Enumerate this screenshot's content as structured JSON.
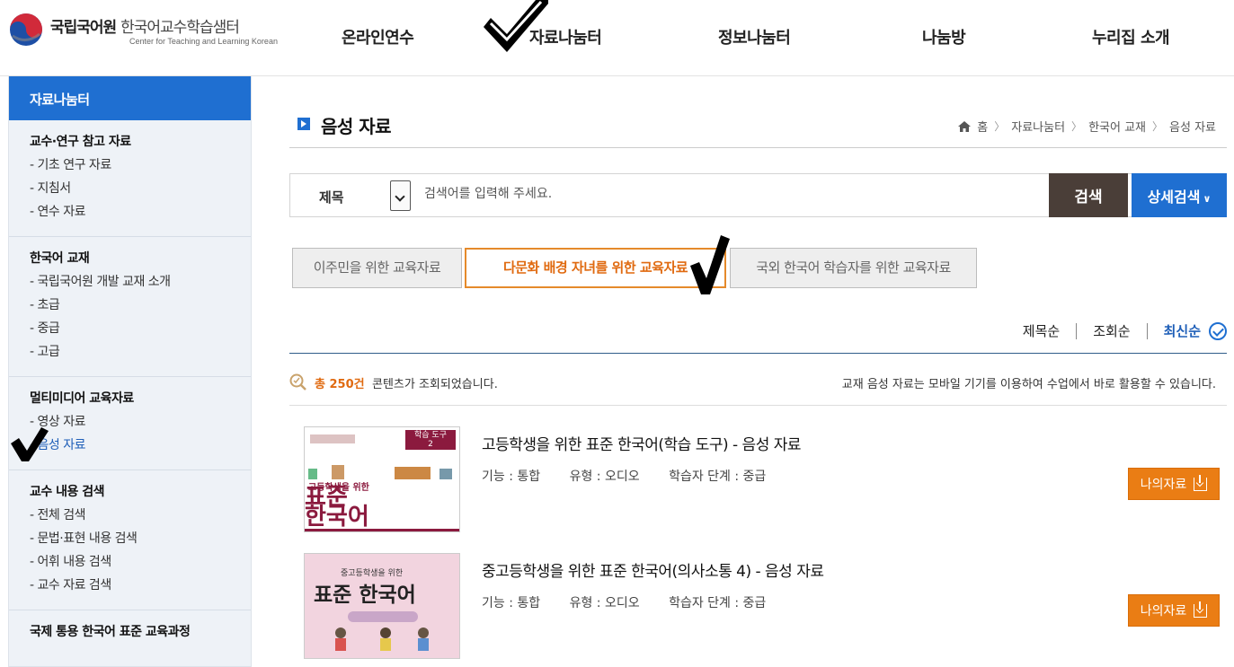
{
  "header": {
    "logo_title": "국립국어원",
    "logo_subtitle": "한국어교수학습샘터",
    "logo_english": "Center for Teaching and Learning Korean",
    "nav": [
      "온라인연수",
      "자료나눔터",
      "정보나눔터",
      "나눔방",
      "누리집 소개"
    ]
  },
  "sidebar": {
    "title": "자료나눔터",
    "groups": [
      {
        "title": "교수·연구 참고 자료",
        "items": [
          "기초 연구 자료",
          "지침서",
          "연수 자료"
        ]
      },
      {
        "title": "한국어 교재",
        "items": [
          "국립국어원 개발 교재 소개",
          "초급",
          "중급",
          "고급"
        ]
      },
      {
        "title": "멀티미디어 교육자료",
        "items": [
          "영상 자료",
          "음성 자료"
        ],
        "active_item": "음성 자료"
      },
      {
        "title": "교수 내용 검색",
        "items": [
          "전체 검색",
          "문법·표현 내용 검색",
          "어휘 내용 검색",
          "교수 자료 검색"
        ]
      },
      {
        "title": "국제 통용 한국어 표준 교육과정",
        "items": []
      }
    ]
  },
  "main": {
    "page_title": "음성 자료",
    "breadcrumb": [
      "홈",
      "자료나눔터",
      "한국어 교재",
      "음성 자료"
    ],
    "search": {
      "category": "제목",
      "placeholder": "검색어를 입력해 주세요.",
      "search_label": "검색",
      "advanced_label": "상세검색"
    },
    "category_tabs": [
      {
        "label": "이주민을 위한 교육자료",
        "active": false
      },
      {
        "label": "다문화 배경 자녀를 위한 교육자료",
        "active": true
      },
      {
        "label": "국외 한국어 학습자를 위한 교육자료",
        "active": false
      }
    ],
    "sort": {
      "options": [
        "제목순",
        "조회순",
        "최신순"
      ],
      "selected": "최신순"
    },
    "count": {
      "total": "총 250건",
      "text": "콘텐츠가 조회되었습니다.",
      "note": "교재 음성 자료는 모바일 기기를 이용하여 수업에서 바로 활용할 수 있습니다."
    },
    "items": [
      {
        "title": "고등학생을 위한 표준 한국어(학습 도구) - 음성 자료",
        "function": "기능 : 통합",
        "type": "유형 : 오디오",
        "level": "학습자 단계 : 중급",
        "button": "나의자료",
        "thumb": {
          "badge": "학습 도구",
          "badge_num": "2",
          "line1": "고등학생을 위한",
          "line2": "표준",
          "line3": "한국어",
          "color": "#8b1a3e"
        }
      },
      {
        "title": "중고등학생을 위한 표준 한국어(의사소통 4) - 음성 자료",
        "function": "기능 : 통합",
        "type": "유형 : 오디오",
        "level": "학습자 단계 : 중급",
        "button": "나의자료",
        "thumb": {
          "line1": "중고등학생을 위한",
          "line2": "표준 한국어",
          "color": "#f2d4df"
        }
      }
    ]
  },
  "colors": {
    "brand_blue": "#1f6fd1",
    "search_dark": "#4a3e38",
    "accent_orange": "#ea7d14"
  }
}
